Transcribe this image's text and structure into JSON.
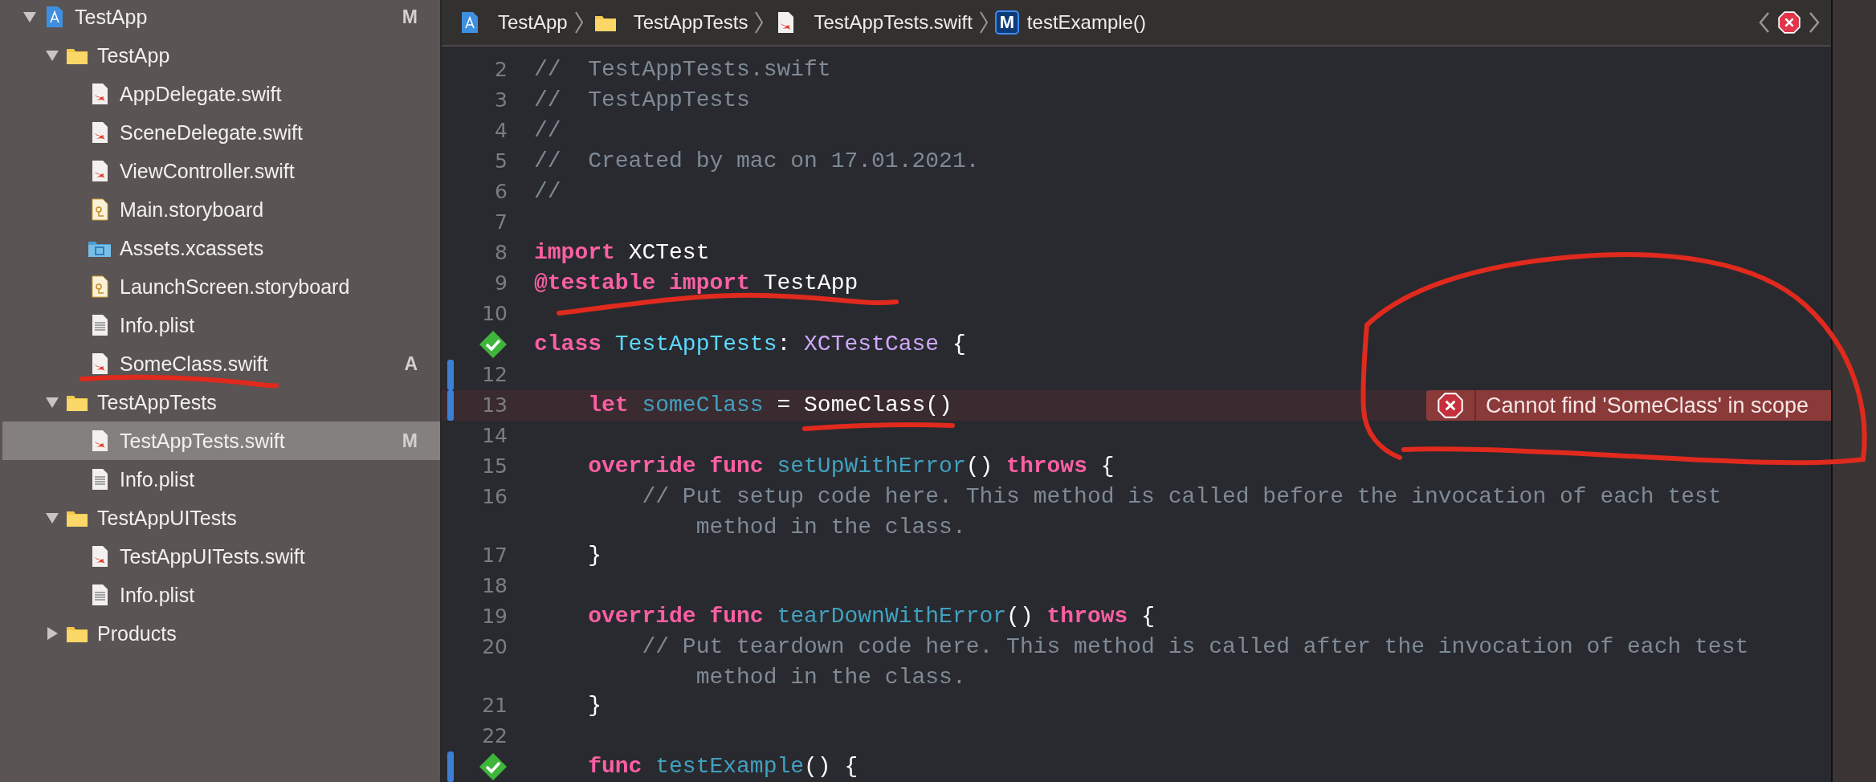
{
  "navigator": {
    "items": [
      {
        "label": "TestApp",
        "kind": "project",
        "badge": "M",
        "selected": false,
        "expanded": true,
        "children": [
          {
            "label": "TestApp",
            "kind": "folder",
            "selected": false,
            "expanded": true,
            "children": [
              {
                "label": "AppDelegate.swift",
                "kind": "swift",
                "selected": false
              },
              {
                "label": "SceneDelegate.swift",
                "kind": "swift",
                "selected": false
              },
              {
                "label": "ViewController.swift",
                "kind": "swift",
                "selected": false
              },
              {
                "label": "Main.storyboard",
                "kind": "storyboard",
                "selected": false
              },
              {
                "label": "Assets.xcassets",
                "kind": "assets",
                "selected": false
              },
              {
                "label": "LaunchScreen.storyboard",
                "kind": "storyboard",
                "selected": false
              },
              {
                "label": "Info.plist",
                "kind": "plist",
                "selected": false
              },
              {
                "label": "SomeClass.swift",
                "kind": "swift",
                "badge": "A",
                "selected": false
              }
            ]
          },
          {
            "label": "TestAppTests",
            "kind": "folder",
            "selected": false,
            "expanded": true,
            "children": [
              {
                "label": "TestAppTests.swift",
                "kind": "swift",
                "badge": "M",
                "selected": true
              },
              {
                "label": "Info.plist",
                "kind": "plist",
                "selected": false
              }
            ]
          },
          {
            "label": "TestAppUITests",
            "kind": "folder",
            "selected": false,
            "expanded": true,
            "children": [
              {
                "label": "TestAppUITests.swift",
                "kind": "swift",
                "selected": false
              },
              {
                "label": "Info.plist",
                "kind": "plist",
                "selected": false
              }
            ]
          },
          {
            "label": "Products",
            "kind": "folder",
            "selected": false,
            "expanded": false
          }
        ]
      }
    ]
  },
  "breadcrumb": [
    {
      "label": "TestApp",
      "kind": "project"
    },
    {
      "label": "TestAppTests",
      "kind": "folder"
    },
    {
      "label": "TestAppTests.swift",
      "kind": "swift"
    },
    {
      "label": "testExample()",
      "kind": "method",
      "icon_text": "M"
    }
  ],
  "editor": {
    "lines": [
      {
        "number": "2",
        "tokens": [
          {
            "text": "//  TestAppTests.swift",
            "kind": "comment"
          }
        ]
      },
      {
        "number": "3",
        "tokens": [
          {
            "text": "//  TestAppTests",
            "kind": "comment"
          }
        ]
      },
      {
        "number": "4",
        "tokens": [
          {
            "text": "//",
            "kind": "comment"
          }
        ]
      },
      {
        "number": "5",
        "tokens": [
          {
            "text": "//  Created by mac on 17.01.2021.",
            "kind": "comment"
          }
        ]
      },
      {
        "number": "6",
        "tokens": [
          {
            "text": "//",
            "kind": "comment"
          }
        ]
      },
      {
        "number": "7"
      },
      {
        "number": "8",
        "tokens": [
          {
            "text": "import",
            "kind": "keyword"
          },
          {
            "text": " XCTest",
            "kind": "plain"
          }
        ]
      },
      {
        "number": "9",
        "tokens": [
          {
            "text": "@testable",
            "kind": "keyword"
          },
          {
            "text": " import",
            "kind": "keyword"
          },
          {
            "text": " TestApp",
            "kind": "plain"
          }
        ]
      },
      {
        "number": "10"
      },
      {
        "test_passed": true,
        "tokens": [
          {
            "text": "class",
            "kind": "keyword"
          },
          {
            "text": " TestAppTests",
            "kind": "declaration"
          },
          {
            "text": ":",
            "kind": "plain"
          },
          {
            "text": " XCTestCase",
            "kind": "type"
          },
          {
            "text": " {",
            "kind": "plain"
          }
        ]
      },
      {
        "number": "12",
        "changed": true
      },
      {
        "number": "13",
        "changed": true,
        "error": "Cannot find 'SomeClass' in scope",
        "tokens": [
          {
            "text": "    let",
            "kind": "keyword"
          },
          {
            "text": " someClass",
            "kind": "identifier"
          },
          {
            "text": " = SomeClass()",
            "kind": "plain"
          }
        ]
      },
      {
        "number": "14"
      },
      {
        "number": "15",
        "tokens": [
          {
            "text": "    override",
            "kind": "keyword"
          },
          {
            "text": " func",
            "kind": "keyword"
          },
          {
            "text": " setUpWithError",
            "kind": "identifier"
          },
          {
            "text": "()",
            "kind": "plain"
          },
          {
            "text": " throws",
            "kind": "keyword"
          },
          {
            "text": " {",
            "kind": "plain"
          }
        ]
      },
      {
        "number": "16",
        "tokens": [
          {
            "text": "        // Put setup code here. This method is called before the invocation of each test",
            "kind": "comment"
          }
        ],
        "wrap": "method in the class."
      },
      {
        "number": "17",
        "tokens": [
          {
            "text": "    }",
            "kind": "plain"
          }
        ]
      },
      {
        "number": "18"
      },
      {
        "number": "19",
        "tokens": [
          {
            "text": "    override",
            "kind": "keyword"
          },
          {
            "text": " func",
            "kind": "keyword"
          },
          {
            "text": " tearDownWithError",
            "kind": "identifier"
          },
          {
            "text": "()",
            "kind": "plain"
          },
          {
            "text": " throws",
            "kind": "keyword"
          },
          {
            "text": " {",
            "kind": "plain"
          }
        ]
      },
      {
        "number": "20",
        "tokens": [
          {
            "text": "        // Put teardown code here. This method is called after the invocation of each test",
            "kind": "comment"
          }
        ],
        "wrap": "method in the class."
      },
      {
        "number": "21",
        "tokens": [
          {
            "text": "    }",
            "kind": "plain"
          }
        ]
      },
      {
        "number": "22"
      },
      {
        "test_passed": true,
        "changed": true,
        "tokens": [
          {
            "text": "    func",
            "kind": "keyword"
          },
          {
            "text": " testExample",
            "kind": "identifier"
          },
          {
            "text": "() {",
            "kind": "plain"
          }
        ]
      }
    ]
  }
}
